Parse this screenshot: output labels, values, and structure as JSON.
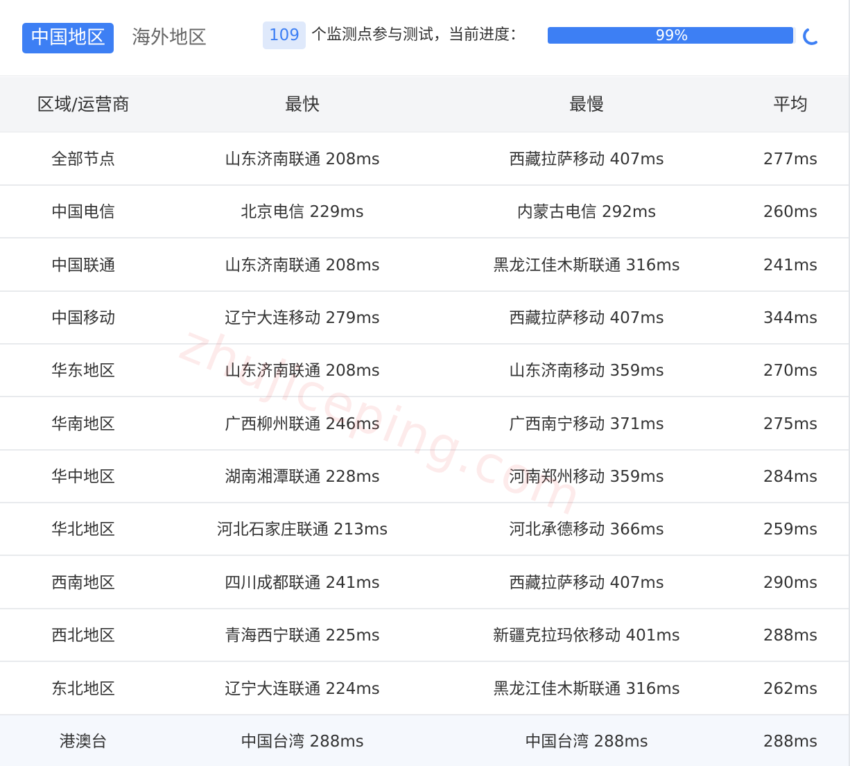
{
  "tabs": {
    "domestic": "中国地区",
    "overseas": "海外地区"
  },
  "progress": {
    "node_count": "109",
    "text": "个监测点参与测试，当前进度：",
    "percent_label": "99%",
    "percent_value": 99
  },
  "table": {
    "headers": [
      "区域/运营商",
      "最快",
      "最慢",
      "平均"
    ],
    "rows": [
      [
        "全部节点",
        "山东济南联通 208ms",
        "西藏拉萨移动 407ms",
        "277ms"
      ],
      [
        "中国电信",
        "北京电信 229ms",
        "内蒙古电信 292ms",
        "260ms"
      ],
      [
        "中国联通",
        "山东济南联通 208ms",
        "黑龙江佳木斯联通 316ms",
        "241ms"
      ],
      [
        "中国移动",
        "辽宁大连移动 279ms",
        "西藏拉萨移动 407ms",
        "344ms"
      ],
      [
        "华东地区",
        "山东济南联通 208ms",
        "山东济南移动 359ms",
        "270ms"
      ],
      [
        "华南地区",
        "广西柳州联通 246ms",
        "广西南宁移动 371ms",
        "275ms"
      ],
      [
        "华中地区",
        "湖南湘潭联通 228ms",
        "河南郑州移动 359ms",
        "284ms"
      ],
      [
        "华北地区",
        "河北石家庄联通 213ms",
        "河北承德移动 366ms",
        "259ms"
      ],
      [
        "西南地区",
        "四川成都联通 241ms",
        "西藏拉萨移动 407ms",
        "290ms"
      ],
      [
        "西北地区",
        "青海西宁联通 225ms",
        "新疆克拉玛依移动 401ms",
        "288ms"
      ],
      [
        "东北地区",
        "辽宁大连联通 224ms",
        "黑龙江佳木斯联通 316ms",
        "262ms"
      ],
      [
        "港澳台",
        "中国台湾 288ms",
        "中国台湾 288ms",
        "288ms"
      ]
    ]
  },
  "watermark": "zhujiceping.com",
  "icons": {
    "loading": "spinner-icon"
  },
  "colors": {
    "accent": "#3d7ff4",
    "badge_bg": "#dfe9fb",
    "header_bg": "#f4f5f7",
    "last_row_bg": "#f5f8fd"
  }
}
